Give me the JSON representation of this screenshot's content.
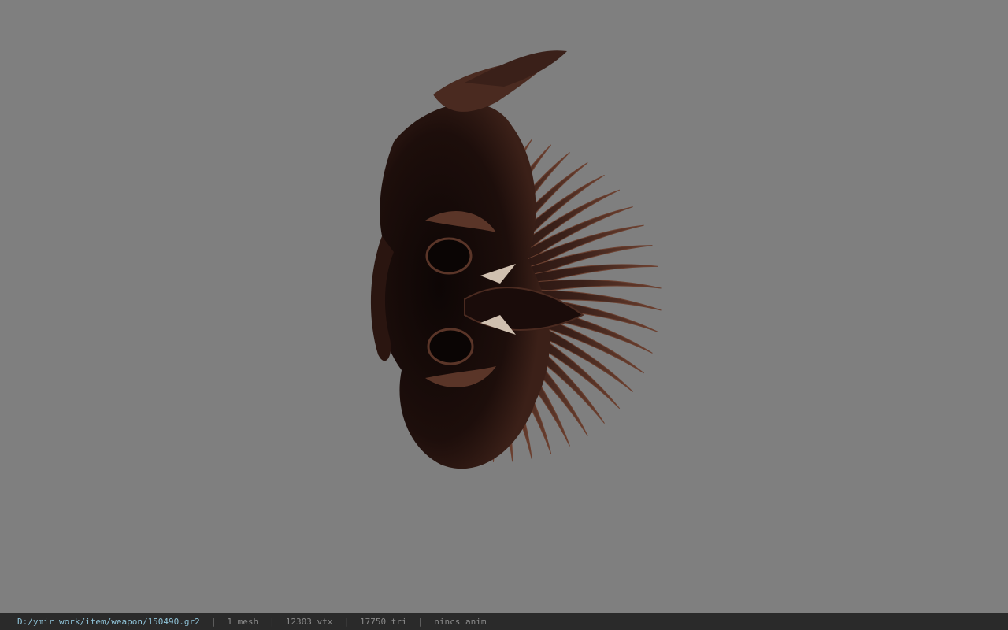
{
  "viewport": {
    "background_color": "#7f7f7f",
    "model_color_primary": "#5a3528",
    "model_color_dark": "#1a0c0a"
  },
  "statusbar": {
    "file_path": "D:/ymir work/item/weapon/150490.gr2",
    "separator": "|",
    "mesh_count": "1 mesh",
    "vertex_count": "12303 vtx",
    "triangle_count": "17750 tri",
    "animation_status": "nincs anim",
    "path_color": "#8fc3d8",
    "text_color": "#8a8a8a"
  }
}
